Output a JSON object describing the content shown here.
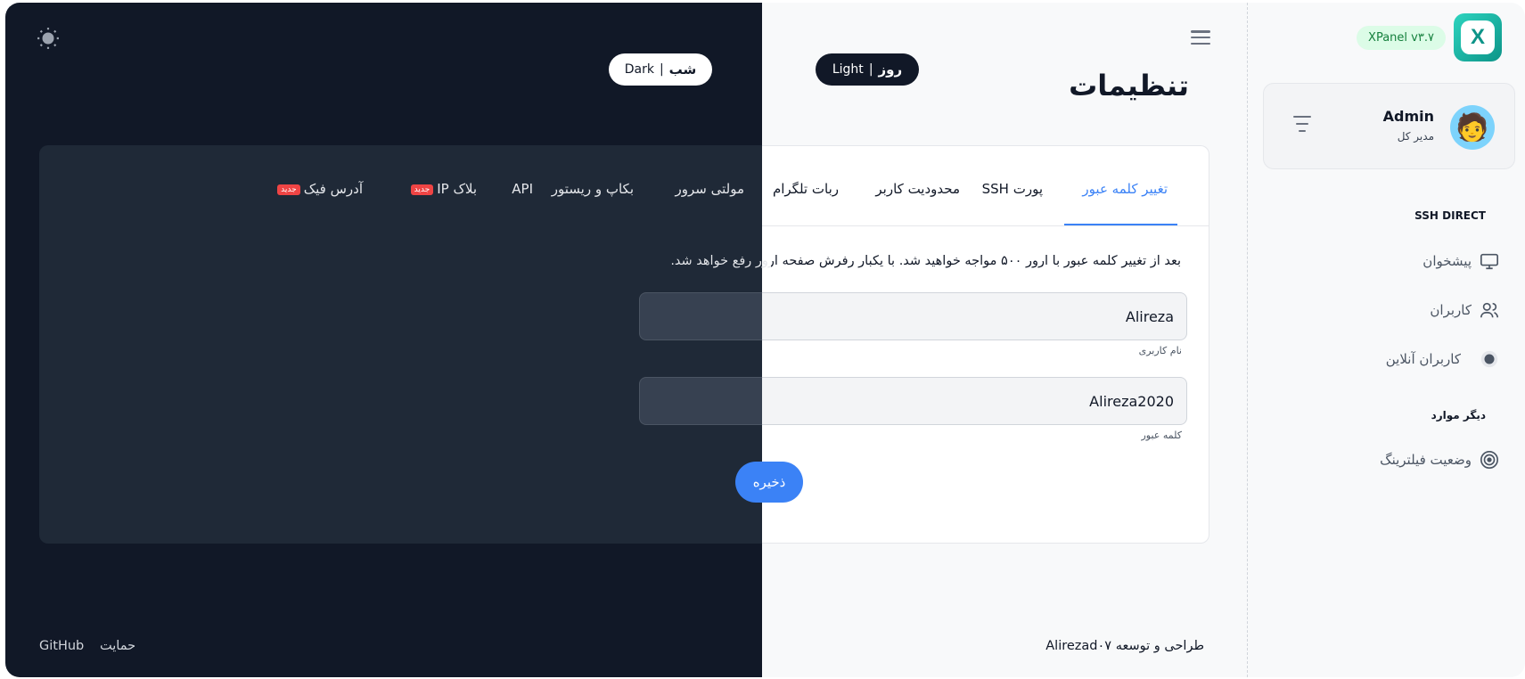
{
  "theme_toggle": {
    "dark_label": "Dark",
    "dark_separator": "|",
    "dark_label_fa": "شب",
    "light_label": "Light",
    "light_separator": "|",
    "light_label_fa": "روز",
    "sun_icon": "sun-icon"
  },
  "header": {
    "title": "تنظیمات",
    "menu_icon": "hamburger-menu-icon"
  },
  "tabs": [
    {
      "label": "تغییر کلمه عبور",
      "active": true
    },
    {
      "label": "پورت SSH"
    },
    {
      "label": "محدودیت کاربر"
    },
    {
      "label": "ربات تلگرام"
    },
    {
      "label": "مولتی سرور"
    },
    {
      "label": "بکاپ و ریستور"
    },
    {
      "label": "API"
    },
    {
      "label": "بلاک IP",
      "badge": "جدید"
    },
    {
      "label": "آدرس فیک",
      "badge": "جدید"
    }
  ],
  "form": {
    "notice": "بعد از تغییر کلمه عبور با ارور ۵۰۰ مواجه خواهید شد. با یکبار رفرش صفحه ارور رفع خواهد شد.",
    "username_value": "Alireza",
    "username_label": "نام کاربری",
    "password_value": "Alireza2020",
    "password_label": "کلمه عبور",
    "save_label": "ذخیره"
  },
  "footer": {
    "credit": "طراحی و توسعه Alirezad۰۷",
    "support": "حمایت",
    "github": "GitHub"
  },
  "sidebar": {
    "version": "XPanel v۳.۷",
    "logo_letter": "X",
    "user": {
      "name": "Admin",
      "role": "مدیر کل"
    },
    "sections": [
      {
        "title": "SSH DIRECT",
        "items": [
          {
            "label": "پیشخوان",
            "icon": "dashboard-icon"
          },
          {
            "label": "کاربران",
            "icon": "users-icon"
          },
          {
            "label": "کاربران آنلاین",
            "icon": "online-icon"
          }
        ]
      },
      {
        "title": "دیگر موارد",
        "items": [
          {
            "label": "وضعیت فیلترینگ",
            "icon": "target-icon"
          }
        ]
      }
    ]
  },
  "colors": {
    "accent": "#3b82f6",
    "dark_bg": "#111827",
    "dark_card": "#1f2937",
    "light_bg": "#f8f9fa",
    "badge_red": "#ef4444",
    "version_green": "#15803d"
  }
}
